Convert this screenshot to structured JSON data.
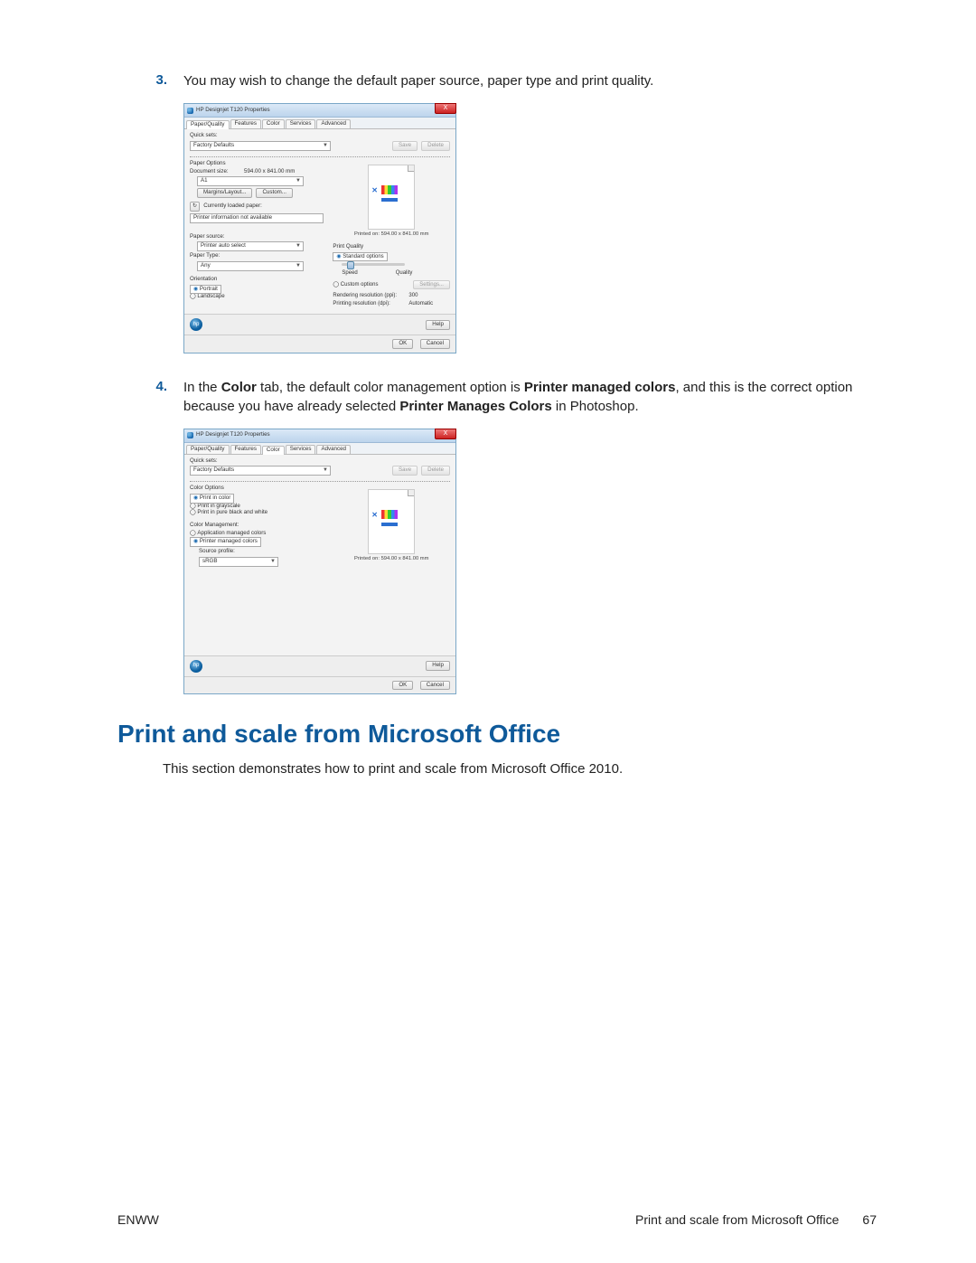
{
  "steps": {
    "s3": {
      "num": "3.",
      "text": "You may wish to change the default paper source, paper type and print quality."
    },
    "s4": {
      "num": "4.",
      "prefix": "In the ",
      "b1": "Color",
      "mid1": " tab, the default color management option is ",
      "b2": "Printer managed colors",
      "mid2": ", and this is the correct option because you have already selected ",
      "b3": "Printer Manages Colors",
      "suffix": " in Photoshop."
    }
  },
  "dlg": {
    "title": "HP Designjet T120 Properties",
    "close": "X",
    "tabs": {
      "pq": "Paper/Quality",
      "feat": "Features",
      "color": "Color",
      "serv": "Services",
      "adv": "Advanced"
    },
    "quicksets": {
      "label": "Quick sets:",
      "value": "Factory Defaults",
      "save": "Save",
      "delete": "Delete"
    },
    "paperopts": {
      "title": "Paper Options",
      "docsize_l": "Document size:",
      "docsize_v": "594.00 x 841.00 mm",
      "a1": "A1",
      "margins": "Margins/Layout...",
      "custom": "Custom...",
      "loaded": "Currently loaded paper:",
      "info": "Printer information not available"
    },
    "preview": "Printed on: 594.00 x 841.00 mm",
    "source": {
      "label": "Paper source:",
      "value": "Printer auto select"
    },
    "ptype": {
      "label": "Paper Type:",
      "value": "Any"
    },
    "orient": {
      "label": "Orientation",
      "portrait": "Portrait",
      "landscape": "Landscape"
    },
    "quality": {
      "title": "Print Quality",
      "std": "Standard options",
      "speed": "Speed",
      "qual": "Quality",
      "custom": "Custom options",
      "settings": "Settings...",
      "rres_l": "Rendering resolution (ppi):",
      "rres_v": "300",
      "pres_l": "Printing resolution (dpi):",
      "pres_v": "Automatic"
    },
    "coloropts": {
      "title": "Color Options",
      "pic": "Print in color",
      "pig": "Print in grayscale",
      "pbw": "Print in pure black and white"
    },
    "cmgmt": {
      "title": "Color Management:",
      "app": "Application managed colors",
      "prn": "Printer managed colors",
      "srcprof_l": "Source profile:",
      "srcprof_v": "sRGB"
    },
    "help": "Help",
    "ok": "OK",
    "cancel": "Cancel"
  },
  "section": {
    "heading": "Print and scale from Microsoft Office",
    "body": "This section demonstrates how to print and scale from Microsoft Office 2010."
  },
  "footer": {
    "left": "ENWW",
    "right": "Print and scale from Microsoft Office",
    "page": "67"
  }
}
